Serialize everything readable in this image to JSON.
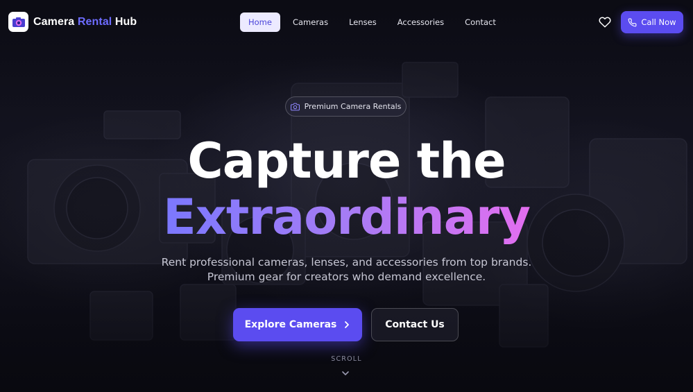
{
  "brand": {
    "name_part1": "Camera",
    "name_part2": "Rental",
    "name_part3": "Hub",
    "accent_color": "#6d6cff"
  },
  "nav": {
    "items": [
      {
        "label": "Home",
        "active": true
      },
      {
        "label": "Cameras",
        "active": false
      },
      {
        "label": "Lenses",
        "active": false
      },
      {
        "label": "Accessories",
        "active": false
      },
      {
        "label": "Contact",
        "active": false
      }
    ],
    "wishlist_icon": "heart-icon",
    "call_label": "Call Now",
    "call_icon": "phone-icon"
  },
  "hero": {
    "badge_text": "Premium Camera Rentals",
    "badge_icon": "camera-icon",
    "heading_line1": "Capture the",
    "heading_line2": "Extraordinary",
    "subtitle_line1": "Rent professional cameras, lenses, and accessories from top brands.",
    "subtitle_line2": "Premium gear for creators who demand excellence.",
    "primary_cta": "Explore Cameras",
    "secondary_cta": "Contact Us",
    "scroll_label": "SCROLL"
  },
  "colors": {
    "primary": "#5b4cf0",
    "gradient_start": "#7b78ff",
    "gradient_end": "#e36ef0",
    "background": "#0b0b14"
  }
}
